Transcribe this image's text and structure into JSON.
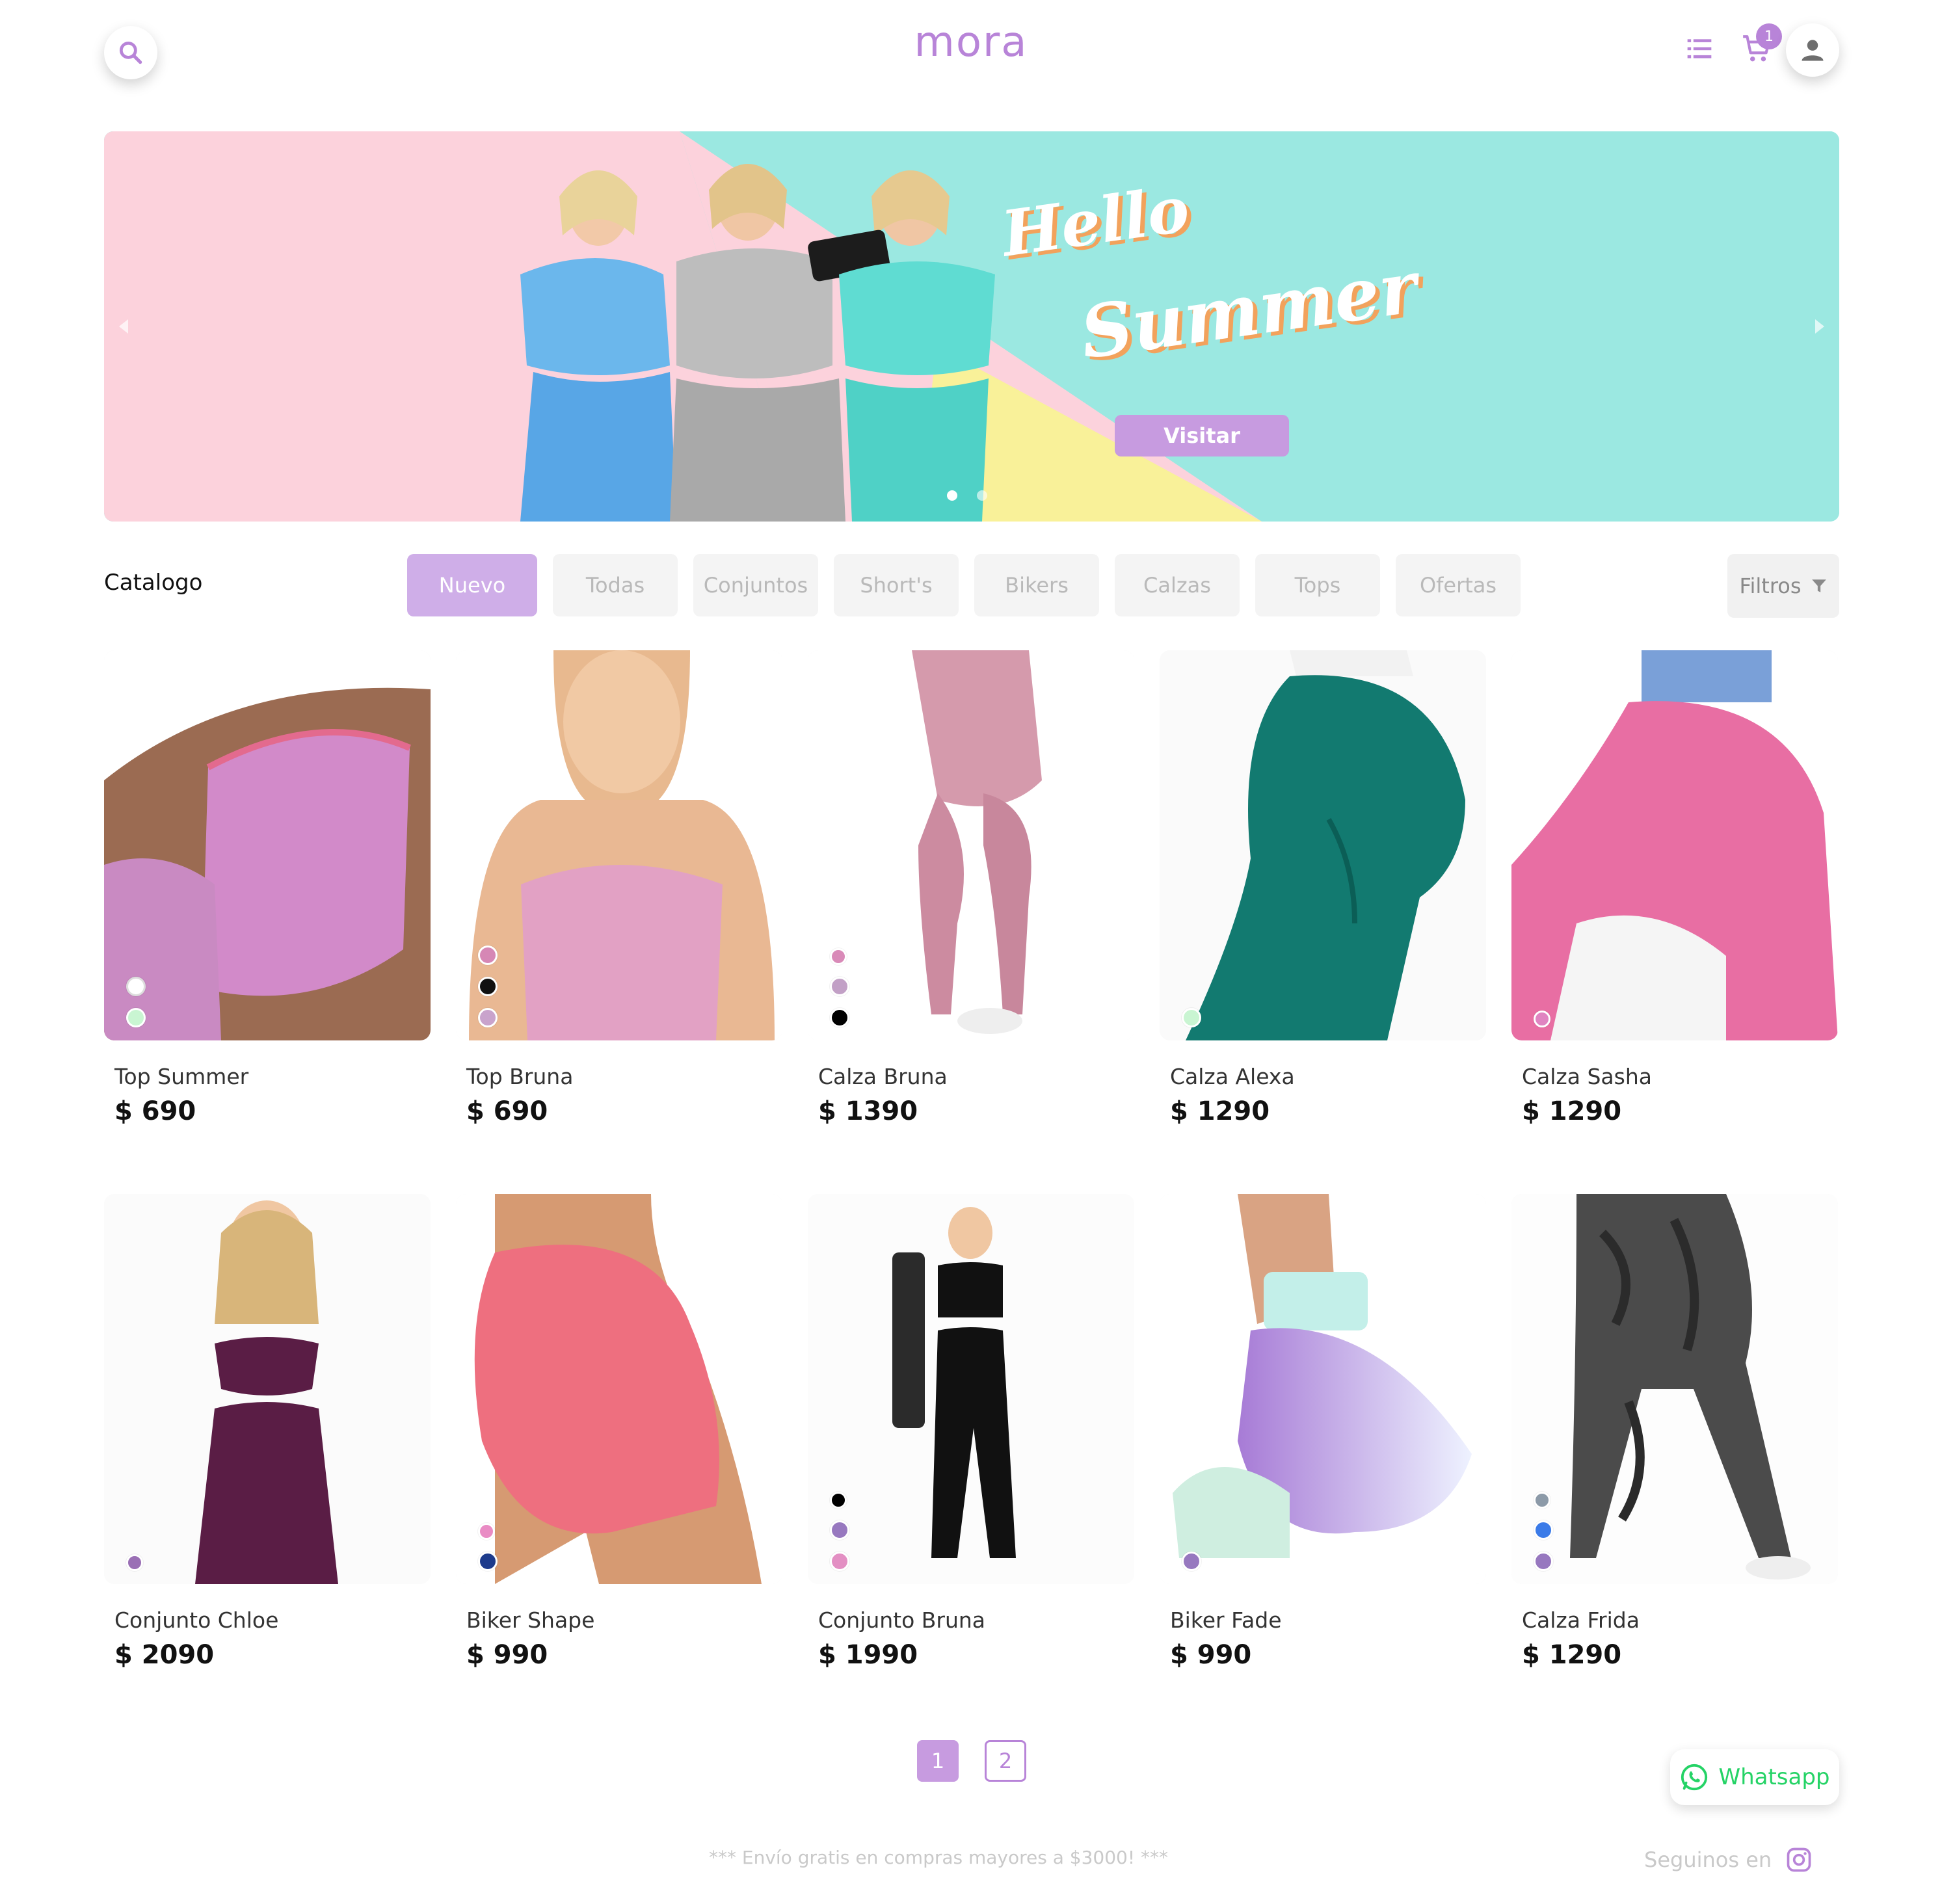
{
  "header": {
    "logo": "mora",
    "cart_count": "1"
  },
  "banner": {
    "line1": "Hello",
    "line2": "Summer",
    "button": "Visitar",
    "colors": {
      "pink": "#fcd2dc",
      "teal": "#9be8e1",
      "yellow": "#f9f199"
    }
  },
  "catalog": {
    "title": "Catalogo",
    "tabs": [
      "Nuevo",
      "Todas",
      "Conjuntos",
      "Short's",
      "Bikers",
      "Calzas",
      "Tops",
      "Ofertas"
    ],
    "active_tab": "Nuevo",
    "filter_label": "Filtros"
  },
  "products": [
    {
      "name": "Top Summer",
      "price": "$ 690",
      "swatches": [
        "#ffffff",
        "#c9f5d2"
      ]
    },
    {
      "name": "Top Bruna",
      "price": "$ 690",
      "swatches": [
        "#d687b5",
        "#111111",
        "#c9a3cc"
      ]
    },
    {
      "name": "Calza Bruna",
      "price": "$ 1390",
      "swatches": [
        "#d98ab8",
        "#c2a0c6",
        "#000000"
      ]
    },
    {
      "name": "Calza Alexa",
      "price": "$ 1290",
      "swatches": [
        "#c9f5d2"
      ]
    },
    {
      "name": "Calza Sasha",
      "price": "$ 1290",
      "swatches": [
        "#e084c1"
      ]
    },
    {
      "name": "Conjunto Chloe",
      "price": "$ 2090",
      "swatches": [
        "#9a6fb5"
      ]
    },
    {
      "name": "Biker Shape",
      "price": "$ 990",
      "swatches": [
        "#e98bc4",
        "#1d3b8c"
      ]
    },
    {
      "name": "Conjunto Bruna",
      "price": "$ 1990",
      "swatches": [
        "#000000",
        "#9778bf",
        "#e38fc3"
      ]
    },
    {
      "name": "Biker Fade",
      "price": "$ 990",
      "swatches": [
        "#9778bf"
      ]
    },
    {
      "name": "Calza Frida",
      "price": "$ 1290",
      "swatches": [
        "#8c9aa8",
        "#3b7be8",
        "#9778bf"
      ]
    }
  ],
  "pagination": {
    "pages": [
      "1",
      "2"
    ],
    "current": "1"
  },
  "whatsapp": {
    "label": "Whatsapp"
  },
  "footer": {
    "shipping": "*** Envío gratis en compras mayores a $3000! ***",
    "follow": "Seguinos en"
  },
  "colors": {
    "accent": "#b884d8",
    "whatsapp": "#25d366"
  }
}
